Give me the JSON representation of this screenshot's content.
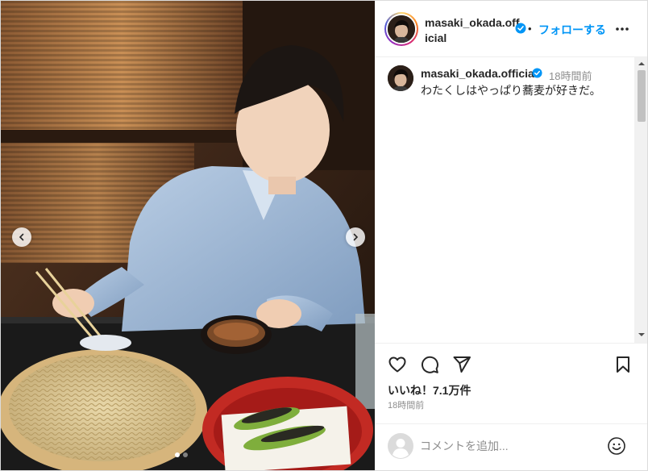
{
  "post": {
    "username": "masaki_okada.official",
    "header_username": "masaki_okada.official",
    "separator": "•",
    "follow_label": "フォローする",
    "more_icon": "more-horizontal-icon",
    "verified_icon": "verified-badge-icon",
    "caption": {
      "username": "masaki_okada.official",
      "time": "18時間前",
      "text": "わたくしはやっぱり蕎麦が好きだ。"
    },
    "likes": "いいね！7.1万件",
    "time_ago": "18時間前"
  },
  "media": {
    "carousel": {
      "slide_count": 2,
      "active_index": 0
    },
    "prev_icon": "chevron-left-icon",
    "next_icon": "chevron-right-icon"
  },
  "actions": {
    "icons": [
      "heart-icon",
      "comment-icon",
      "share-icon",
      "bookmark-icon"
    ]
  },
  "comment_form": {
    "placeholder": "コメントを追加...",
    "emoji_icon": "emoji-icon"
  },
  "colors": {
    "accent": "#0095f6",
    "verified": "#0095f6",
    "text": "#262626",
    "muted": "#8e8e8e",
    "border": "#dbdbdb"
  }
}
